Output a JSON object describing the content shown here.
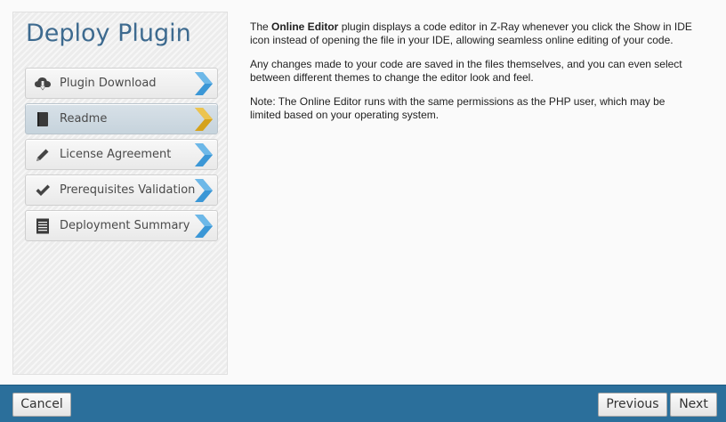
{
  "sidebar": {
    "title": "Deploy Plugin",
    "steps": [
      {
        "label": "Plugin Download",
        "icon": "cloud-download-icon",
        "active": false
      },
      {
        "label": "Readme",
        "icon": "book-icon",
        "active": true
      },
      {
        "label": "License Agreement",
        "icon": "pencil-icon",
        "active": false
      },
      {
        "label": "Prerequisites Validation",
        "icon": "checkmark-icon",
        "active": false
      },
      {
        "label": "Deployment Summary",
        "icon": "document-list-icon",
        "active": false
      }
    ]
  },
  "readme": {
    "p1_before": "The ",
    "p1_bold": "Online Editor",
    "p1_after": " plugin displays a code editor in Z-Ray whenever you click the Show in IDE icon instead of opening the file in your IDE, allowing seamless online editing of your code.",
    "p2": "Any changes made to your code are saved in the files themselves, and you can even select between different themes to change the editor look and feel.",
    "p3": "Note: The Online Editor runs with the same permissions as the PHP user, which may be limited based on your operating system."
  },
  "footer": {
    "cancel_label": "Cancel",
    "previous_label": "Previous",
    "next_label": "Next"
  },
  "colors": {
    "footer_bg": "#2b6f9b",
    "title_color": "#3d6a8f",
    "arrow_blue": "#3b97d6",
    "arrow_gold": "#d5a21b"
  }
}
